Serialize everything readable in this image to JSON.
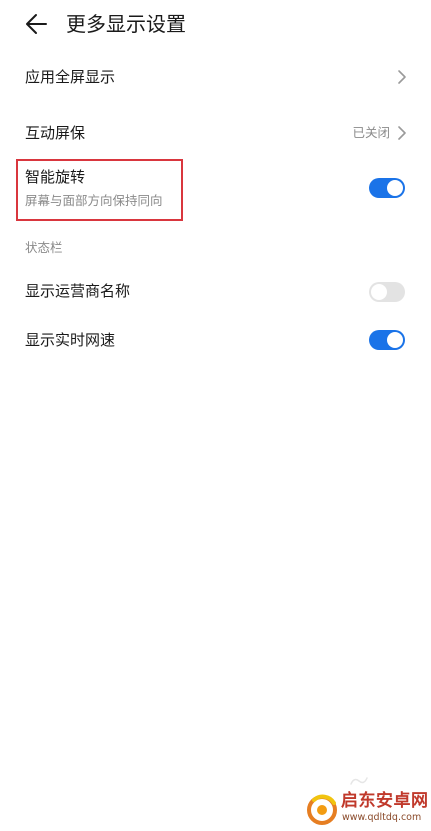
{
  "header": {
    "title": "更多显示设置",
    "back_icon": "arrow-left-icon"
  },
  "rows": {
    "fullscreen_apps": {
      "label": "应用全屏显示"
    },
    "screensaver": {
      "label": "互动屏保",
      "status": "已关闭"
    },
    "smart_rotation": {
      "label": "智能旋转",
      "subtitle": "屏幕与面部方向保持同向",
      "enabled": true
    },
    "carrier_name": {
      "label": "显示运营商名称",
      "enabled": false
    },
    "network_speed": {
      "label": "显示实时网速",
      "enabled": true
    }
  },
  "sections": {
    "status_bar": "状态栏"
  },
  "colors": {
    "accent": "#1a73e8",
    "toggle_off": "#e3e3e3",
    "highlight": "#d9363e",
    "secondary_text": "#8a8a8a"
  },
  "watermark": {
    "title": "启东安卓网",
    "url": "www.qdltdq.com"
  }
}
